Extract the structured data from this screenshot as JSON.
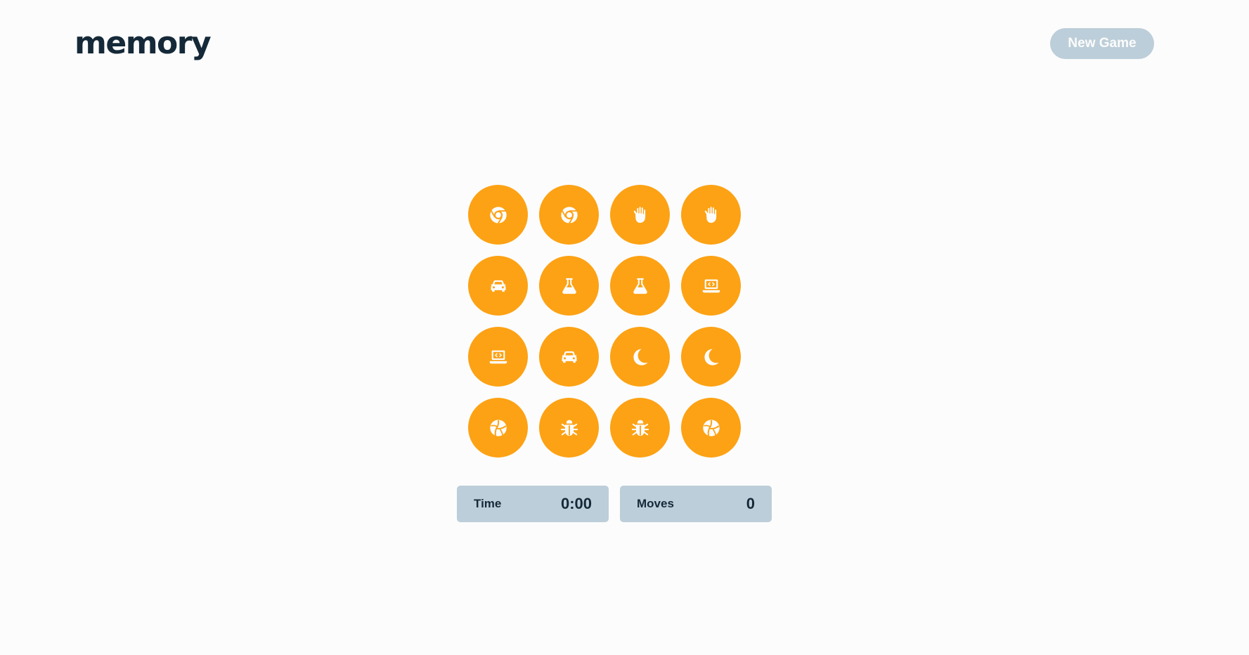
{
  "header": {
    "logo_text": "memory",
    "new_game_label": "New Game"
  },
  "colors": {
    "background": "#FCFCFC",
    "tile": "#FDA214",
    "button": "#BCCED9",
    "text": "#152938"
  },
  "board": {
    "tiles": [
      {
        "icon": "chrome-icon"
      },
      {
        "icon": "chrome-icon"
      },
      {
        "icon": "hand-icon"
      },
      {
        "icon": "hand-icon"
      },
      {
        "icon": "car-icon"
      },
      {
        "icon": "flask-icon"
      },
      {
        "icon": "flask-icon"
      },
      {
        "icon": "laptop-code-icon"
      },
      {
        "icon": "laptop-code-icon"
      },
      {
        "icon": "car-icon"
      },
      {
        "icon": "moon-icon"
      },
      {
        "icon": "moon-icon"
      },
      {
        "icon": "volleyball-icon"
      },
      {
        "icon": "bug-icon"
      },
      {
        "icon": "bug-icon"
      },
      {
        "icon": "volleyball-icon"
      }
    ]
  },
  "stats": {
    "time_label": "Time",
    "time_value": "0:00",
    "moves_label": "Moves",
    "moves_value": "0"
  }
}
